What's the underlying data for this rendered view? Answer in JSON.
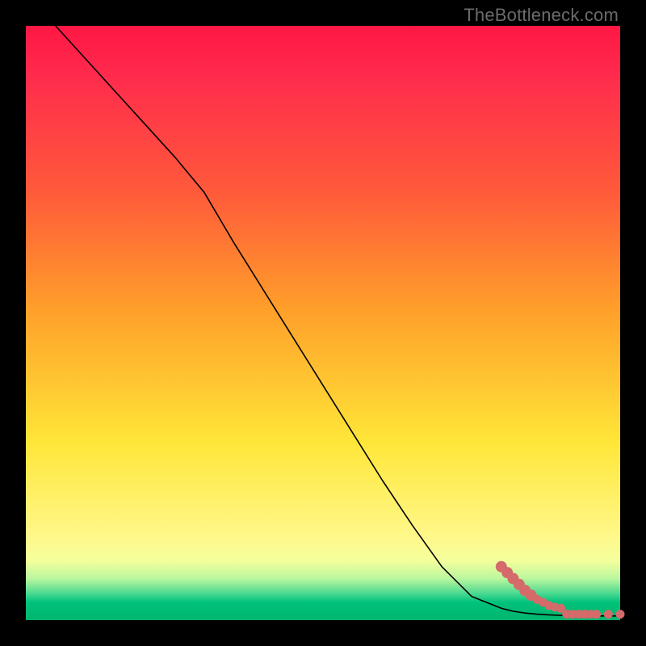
{
  "watermark": "TheBottleneck.com",
  "chart_data": {
    "type": "line",
    "title": "",
    "xlabel": "",
    "ylabel": "",
    "x_range": [
      0,
      100
    ],
    "y_range": [
      0,
      100
    ],
    "series": [
      {
        "name": "bottleneck-curve",
        "x": [
          5,
          10,
          15,
          20,
          25,
          30,
          35,
          40,
          45,
          50,
          55,
          60,
          65,
          70,
          75,
          80,
          82,
          84,
          86,
          88,
          90,
          92,
          94,
          96,
          98,
          100
        ],
        "y": [
          100,
          94.5,
          89,
          83.5,
          78,
          72,
          63.5,
          55.5,
          47.5,
          39.5,
          31.5,
          23.5,
          16,
          9,
          4,
          2,
          1.5,
          1.2,
          1.0,
          0.9,
          0.8,
          0.8,
          0.7,
          0.7,
          0.7,
          0.7
        ]
      }
    ],
    "markers": {
      "name": "highlighted-range",
      "x": [
        80,
        81,
        82,
        83,
        84,
        85,
        86,
        87,
        88,
        89,
        90,
        91,
        92,
        93,
        94,
        95,
        96,
        98,
        100
      ],
      "y": [
        9,
        8,
        7,
        6,
        5,
        4.2,
        3.5,
        3,
        2.5,
        2.2,
        2,
        1,
        1,
        1,
        1,
        1,
        1,
        1,
        1
      ]
    },
    "gradient_stops": [
      {
        "pos": 0.0,
        "color": "#ff1744"
      },
      {
        "pos": 0.28,
        "color": "#ff5a3a"
      },
      {
        "pos": 0.48,
        "color": "#ffa02a"
      },
      {
        "pos": 0.7,
        "color": "#ffe638"
      },
      {
        "pos": 0.9,
        "color": "#f4ff9c"
      },
      {
        "pos": 0.95,
        "color": "#4bd991"
      },
      {
        "pos": 1.0,
        "color": "#00b56e"
      }
    ]
  }
}
